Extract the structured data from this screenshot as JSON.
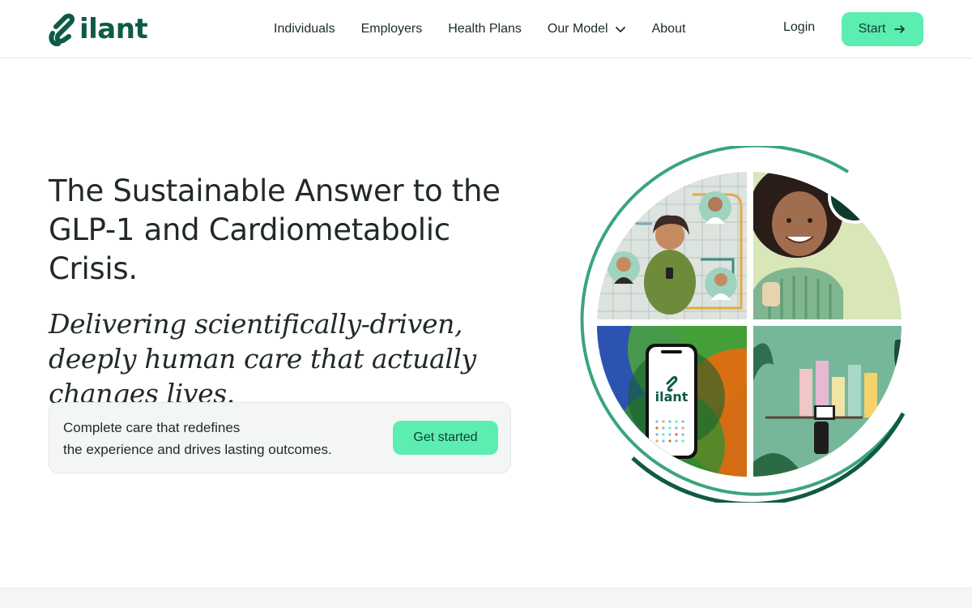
{
  "brand": {
    "name": "ilant",
    "color": "#0f5a47",
    "accent": "#5ceeb0"
  },
  "nav": {
    "items": [
      {
        "label": "Individuals"
      },
      {
        "label": "Employers"
      },
      {
        "label": "Health Plans"
      },
      {
        "label": "Our Model",
        "has_dropdown": true
      },
      {
        "label": "About"
      }
    ],
    "login_label": "Login",
    "start_label": "Start"
  },
  "hero": {
    "title": "The Sustainable Answer to the GLP-1 and Cardiometabolic Crisis.",
    "subtitle": "Delivering scientifically-driven, deeply human care that actually changes lives.",
    "cta_text_line1": "Complete care that redefines",
    "cta_text_line2": "the experience and drives lasting outcomes.",
    "cta_button": "Get started"
  },
  "illustration": {
    "phone_brand": "ilant",
    "icons": [
      "chevron-down-icon",
      "arrow-right-icon",
      "ilant-logo-icon"
    ]
  }
}
